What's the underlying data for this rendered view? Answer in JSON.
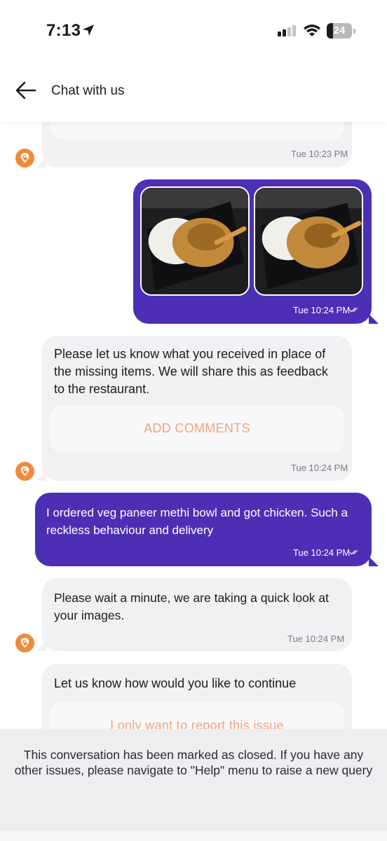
{
  "status_bar": {
    "time": "7:13",
    "battery": "24",
    "icons": [
      "location-arrow-icon",
      "cellular-signal-icon",
      "wifi-icon",
      "battery-icon"
    ]
  },
  "header": {
    "title": "Chat with us",
    "back_icon": "arrow-left-icon"
  },
  "messages": [
    {
      "from": "support",
      "timestamp": "Tue 10:23 PM"
    },
    {
      "from": "user",
      "type": "images",
      "images": [
        "food-photo-1",
        "food-photo-2"
      ],
      "timestamp": "Tue 10:24 PM",
      "read_icon": "double-check-icon"
    },
    {
      "from": "support",
      "text": "Please let us know what you received in place of the missing items. We will share this as feedback to the restaurant.",
      "action_label": "ADD COMMENTS",
      "timestamp": "Tue 10:24 PM"
    },
    {
      "from": "user",
      "text": "I ordered veg paneer methi bowl and got chicken. Such a reckless behaviour and delivery",
      "timestamp": "Tue 10:24 PM",
      "read_icon": "double-check-icon"
    },
    {
      "from": "support",
      "text": "Please wait a minute, we are taking a quick look at your images.",
      "timestamp": "Tue 10:24 PM"
    },
    {
      "from": "support",
      "text": "Let us know how would you like to continue",
      "option_label": "I only want to report this issue"
    }
  ],
  "closed_banner": {
    "text": "This conversation has been marked as closed. If you have any other issues, please navigate to \"Help\" menu to raise a new query"
  },
  "colors": {
    "brand_orange": "#f08a3a",
    "user_bubble": "#4d2fb5",
    "support_bubble": "#f1f1f4",
    "action_text": "#f2a37b"
  }
}
